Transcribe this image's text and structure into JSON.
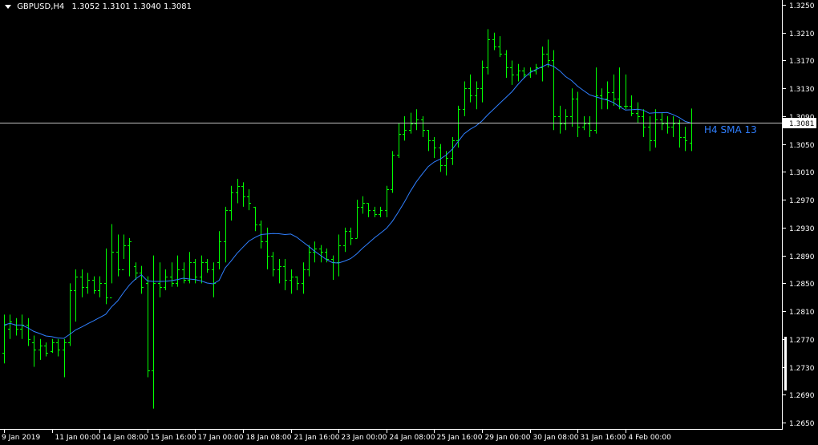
{
  "header": {
    "symbol": "GBPUSD,H4",
    "ohlc": "1.3052 1.3101 1.3040 1.3081"
  },
  "indicator_label": "H4 SMA 13",
  "current_price_label": "1.3081",
  "colors": {
    "background": "#000000",
    "bars": "#00ff00",
    "sma": "#2f7fff",
    "axis": "#ffffff",
    "price_line": "#c0c0c0",
    "price_tag_bg": "#ffffff",
    "price_tag_text": "#000000"
  },
  "chart_data": {
    "type": "ohlc",
    "symbol": "GBPUSD",
    "timeframe": "H4",
    "ylim": [
      1.2635,
      1.3265
    ],
    "y_ticks": [
      "1.3250",
      "1.3210",
      "1.3170",
      "1.3130",
      "1.3090",
      "1.3050",
      "1.3010",
      "1.2970",
      "1.2930",
      "1.2890",
      "1.2850",
      "1.2810",
      "1.2770",
      "1.2730",
      "1.2690",
      "1.2650"
    ],
    "x_ticks": [
      {
        "label": "9 Jan 2019",
        "bar": 0
      },
      {
        "label": "11 Jan 00:00",
        "bar": 8
      },
      {
        "label": "14 Jan 08:00",
        "bar": 16
      },
      {
        "label": "15 Jan 16:00",
        "bar": 24
      },
      {
        "label": "17 Jan 00:00",
        "bar": 32
      },
      {
        "label": "18 Jan 08:00",
        "bar": 40
      },
      {
        "label": "21 Jan 16:00",
        "bar": 48
      },
      {
        "label": "23 Jan 00:00",
        "bar": 56
      },
      {
        "label": "24 Jan 08:00",
        "bar": 64
      },
      {
        "label": "25 Jan 16:00",
        "bar": 72
      },
      {
        "label": "29 Jan 00:00",
        "bar": 80
      },
      {
        "label": "30 Jan 08:00",
        "bar": 88
      },
      {
        "label": "31 Jan 16:00",
        "bar": 96
      },
      {
        "label": "4 Feb 00:00",
        "bar": 104
      }
    ],
    "bars": [
      {
        "h": 1.2805,
        "l": 1.2735,
        "o": 1.275,
        "c": 1.279
      },
      {
        "h": 1.2805,
        "l": 1.277,
        "o": 1.2785,
        "c": 1.2795
      },
      {
        "h": 1.28,
        "l": 1.2775,
        "o": 1.279,
        "c": 1.2785
      },
      {
        "h": 1.2805,
        "l": 1.277,
        "o": 1.2785,
        "c": 1.279
      },
      {
        "h": 1.28,
        "l": 1.276,
        "o": 1.279,
        "c": 1.277
      },
      {
        "h": 1.2775,
        "l": 1.273,
        "o": 1.2765,
        "c": 1.2755
      },
      {
        "h": 1.277,
        "l": 1.274,
        "o": 1.2755,
        "c": 1.276
      },
      {
        "h": 1.2765,
        "l": 1.2745,
        "o": 1.276,
        "c": 1.275
      },
      {
        "h": 1.277,
        "l": 1.275,
        "o": 1.2752,
        "c": 1.2765
      },
      {
        "h": 1.277,
        "l": 1.2745,
        "o": 1.2765,
        "c": 1.2755
      },
      {
        "h": 1.277,
        "l": 1.2715,
        "o": 1.2755,
        "c": 1.2765
      },
      {
        "h": 1.285,
        "l": 1.276,
        "o": 1.2765,
        "c": 1.284
      },
      {
        "h": 1.287,
        "l": 1.2795,
        "o": 1.284,
        "c": 1.286
      },
      {
        "h": 1.287,
        "l": 1.283,
        "o": 1.286,
        "c": 1.2845
      },
      {
        "h": 1.2865,
        "l": 1.2835,
        "o": 1.2845,
        "c": 1.2855
      },
      {
        "h": 1.286,
        "l": 1.2835,
        "o": 1.2855,
        "c": 1.284
      },
      {
        "h": 1.286,
        "l": 1.283,
        "o": 1.284,
        "c": 1.285
      },
      {
        "h": 1.29,
        "l": 1.282,
        "o": 1.285,
        "c": 1.283
      },
      {
        "h": 1.2935,
        "l": 1.285,
        "o": 1.283,
        "c": 1.2895
      },
      {
        "h": 1.292,
        "l": 1.286,
        "o": 1.2895,
        "c": 1.287
      },
      {
        "h": 1.292,
        "l": 1.2885,
        "o": 1.287,
        "c": 1.2905
      },
      {
        "h": 1.2915,
        "l": 1.286,
        "o": 1.2905,
        "c": 1.291
      },
      {
        "h": 1.288,
        "l": 1.2855,
        "o": 1.2875,
        "c": 1.2865
      },
      {
        "h": 1.2875,
        "l": 1.2835,
        "o": 1.2865,
        "c": 1.2845
      },
      {
        "h": 1.286,
        "l": 1.2715,
        "o": 1.285,
        "c": 1.2725
      },
      {
        "h": 1.289,
        "l": 1.267,
        "o": 1.2725,
        "c": 1.285
      },
      {
        "h": 1.288,
        "l": 1.283,
        "o": 1.285,
        "c": 1.2845
      },
      {
        "h": 1.287,
        "l": 1.284,
        "o": 1.2845,
        "c": 1.286
      },
      {
        "h": 1.288,
        "l": 1.2845,
        "o": 1.286,
        "c": 1.285
      },
      {
        "h": 1.289,
        "l": 1.2845,
        "o": 1.285,
        "c": 1.287
      },
      {
        "h": 1.288,
        "l": 1.285,
        "o": 1.287,
        "c": 1.2855
      },
      {
        "h": 1.2895,
        "l": 1.285,
        "o": 1.2855,
        "c": 1.288
      },
      {
        "h": 1.2885,
        "l": 1.285,
        "o": 1.288,
        "c": 1.286
      },
      {
        "h": 1.289,
        "l": 1.285,
        "o": 1.286,
        "c": 1.288
      },
      {
        "h": 1.2885,
        "l": 1.2865,
        "o": 1.288,
        "c": 1.287
      },
      {
        "h": 1.288,
        "l": 1.283,
        "o": 1.287,
        "c": 1.285
      },
      {
        "h": 1.2925,
        "l": 1.287,
        "o": 1.288,
        "c": 1.291
      },
      {
        "h": 1.296,
        "l": 1.288,
        "o": 1.291,
        "c": 1.2955
      },
      {
        "h": 1.299,
        "l": 1.294,
        "o": 1.2955,
        "c": 1.298
      },
      {
        "h": 1.3,
        "l": 1.2965,
        "o": 1.298,
        "c": 1.299
      },
      {
        "h": 1.2995,
        "l": 1.296,
        "o": 1.299,
        "c": 1.2975
      },
      {
        "h": 1.2985,
        "l": 1.2955,
        "o": 1.2975,
        "c": 1.2965
      },
      {
        "h": 1.296,
        "l": 1.2925,
        "o": 1.296,
        "c": 1.2935
      },
      {
        "h": 1.294,
        "l": 1.29,
        "o": 1.2935,
        "c": 1.291
      },
      {
        "h": 1.293,
        "l": 1.287,
        "o": 1.291,
        "c": 1.289
      },
      {
        "h": 1.2895,
        "l": 1.286,
        "o": 1.289,
        "c": 1.287
      },
      {
        "h": 1.2885,
        "l": 1.285,
        "o": 1.287,
        "c": 1.2875
      },
      {
        "h": 1.2885,
        "l": 1.284,
        "o": 1.2875,
        "c": 1.2855
      },
      {
        "h": 1.287,
        "l": 1.2835,
        "o": 1.2855,
        "c": 1.286
      },
      {
        "h": 1.286,
        "l": 1.284,
        "o": 1.286,
        "c": 1.285
      },
      {
        "h": 1.288,
        "l": 1.2835,
        "o": 1.285,
        "c": 1.287
      },
      {
        "h": 1.2905,
        "l": 1.286,
        "o": 1.287,
        "c": 1.2895
      },
      {
        "h": 1.291,
        "l": 1.288,
        "o": 1.2895,
        "c": 1.29
      },
      {
        "h": 1.2905,
        "l": 1.288,
        "o": 1.29,
        "c": 1.2895
      },
      {
        "h": 1.29,
        "l": 1.288,
        "o": 1.2895,
        "c": 1.2885
      },
      {
        "h": 1.289,
        "l": 1.2855,
        "o": 1.2885,
        "c": 1.288
      },
      {
        "h": 1.292,
        "l": 1.286,
        "o": 1.288,
        "c": 1.2905
      },
      {
        "h": 1.293,
        "l": 1.2895,
        "o": 1.2905,
        "c": 1.2925
      },
      {
        "h": 1.293,
        "l": 1.2905,
        "o": 1.2925,
        "c": 1.2915
      },
      {
        "h": 1.297,
        "l": 1.2915,
        "o": 1.2915,
        "c": 1.296
      },
      {
        "h": 1.2975,
        "l": 1.295,
        "o": 1.296,
        "c": 1.2965
      },
      {
        "h": 1.2965,
        "l": 1.2945,
        "o": 1.2965,
        "c": 1.2955
      },
      {
        "h": 1.296,
        "l": 1.2945,
        "o": 1.2955,
        "c": 1.295
      },
      {
        "h": 1.296,
        "l": 1.2945,
        "o": 1.295,
        "c": 1.2955
      },
      {
        "h": 1.299,
        "l": 1.2945,
        "o": 1.2955,
        "c": 1.2985
      },
      {
        "h": 1.304,
        "l": 1.298,
        "o": 1.2985,
        "c": 1.3035
      },
      {
        "h": 1.308,
        "l": 1.303,
        "o": 1.3035,
        "c": 1.3065
      },
      {
        "h": 1.309,
        "l": 1.3055,
        "o": 1.3065,
        "c": 1.307
      },
      {
        "h": 1.3095,
        "l": 1.3065,
        "o": 1.307,
        "c": 1.308
      },
      {
        "h": 1.31,
        "l": 1.307,
        "o": 1.308,
        "c": 1.3085
      },
      {
        "h": 1.309,
        "l": 1.306,
        "o": 1.3085,
        "c": 1.307
      },
      {
        "h": 1.307,
        "l": 1.304,
        "o": 1.307,
        "c": 1.3055
      },
      {
        "h": 1.306,
        "l": 1.303,
        "o": 1.3055,
        "c": 1.3045
      },
      {
        "h": 1.305,
        "l": 1.301,
        "o": 1.3045,
        "c": 1.302
      },
      {
        "h": 1.304,
        "l": 1.3005,
        "o": 1.302,
        "c": 1.303
      },
      {
        "h": 1.306,
        "l": 1.302,
        "o": 1.303,
        "c": 1.3055
      },
      {
        "h": 1.3105,
        "l": 1.3045,
        "o": 1.3055,
        "c": 1.31
      },
      {
        "h": 1.314,
        "l": 1.309,
        "o": 1.31,
        "c": 1.313
      },
      {
        "h": 1.315,
        "l": 1.311,
        "o": 1.313,
        "c": 1.312
      },
      {
        "h": 1.314,
        "l": 1.31,
        "o": 1.312,
        "c": 1.313
      },
      {
        "h": 1.317,
        "l": 1.311,
        "o": 1.313,
        "c": 1.316
      },
      {
        "h": 1.3215,
        "l": 1.315,
        "o": 1.316,
        "c": 1.32
      },
      {
        "h": 1.321,
        "l": 1.3185,
        "o": 1.32,
        "c": 1.319
      },
      {
        "h": 1.3205,
        "l": 1.3175,
        "o": 1.319,
        "c": 1.318
      },
      {
        "h": 1.3185,
        "l": 1.3145,
        "o": 1.318,
        "c": 1.316
      },
      {
        "h": 1.317,
        "l": 1.3135,
        "o": 1.316,
        "c": 1.315
      },
      {
        "h": 1.3165,
        "l": 1.314,
        "o": 1.315,
        "c": 1.3155
      },
      {
        "h": 1.316,
        "l": 1.3145,
        "o": 1.3155,
        "c": 1.315
      },
      {
        "h": 1.316,
        "l": 1.3145,
        "o": 1.315,
        "c": 1.3155
      },
      {
        "h": 1.3165,
        "l": 1.315,
        "o": 1.3155,
        "c": 1.316
      },
      {
        "h": 1.319,
        "l": 1.314,
        "o": 1.316,
        "c": 1.318
      },
      {
        "h": 1.32,
        "l": 1.316,
        "o": 1.318,
        "c": 1.317
      },
      {
        "h": 1.3185,
        "l": 1.307,
        "o": 1.317,
        "c": 1.309
      },
      {
        "h": 1.3105,
        "l": 1.3065,
        "o": 1.309,
        "c": 1.308
      },
      {
        "h": 1.31,
        "l": 1.307,
        "o": 1.308,
        "c": 1.309
      },
      {
        "h": 1.313,
        "l": 1.3075,
        "o": 1.309,
        "c": 1.3115
      },
      {
        "h": 1.3125,
        "l": 1.306,
        "o": 1.3115,
        "c": 1.3075
      },
      {
        "h": 1.309,
        "l": 1.307,
        "o": 1.3075,
        "c": 1.308
      },
      {
        "h": 1.309,
        "l": 1.306,
        "o": 1.308,
        "c": 1.307
      },
      {
        "h": 1.316,
        "l": 1.3065,
        "o": 1.307,
        "c": 1.312
      },
      {
        "h": 1.313,
        "l": 1.31,
        "o": 1.312,
        "c": 1.3115
      },
      {
        "h": 1.314,
        "l": 1.31,
        "o": 1.3115,
        "c": 1.3125
      },
      {
        "h": 1.315,
        "l": 1.3105,
        "o": 1.3125,
        "c": 1.3115
      },
      {
        "h": 1.316,
        "l": 1.31,
        "o": 1.3115,
        "c": 1.3105
      },
      {
        "h": 1.315,
        "l": 1.31,
        "o": 1.3105,
        "c": 1.3105
      },
      {
        "h": 1.312,
        "l": 1.309,
        "o": 1.3105,
        "c": 1.3095
      },
      {
        "h": 1.311,
        "l": 1.308,
        "o": 1.3095,
        "c": 1.309
      },
      {
        "h": 1.31,
        "l": 1.306,
        "o": 1.309,
        "c": 1.3075
      },
      {
        "h": 1.309,
        "l": 1.304,
        "o": 1.3075,
        "c": 1.3055
      },
      {
        "h": 1.31,
        "l": 1.3045,
        "o": 1.3055,
        "c": 1.3085
      },
      {
        "h": 1.3095,
        "l": 1.307,
        "o": 1.3085,
        "c": 1.308
      },
      {
        "h": 1.309,
        "l": 1.3065,
        "o": 1.308,
        "c": 1.3075
      },
      {
        "h": 1.309,
        "l": 1.306,
        "o": 1.3075,
        "c": 1.308
      },
      {
        "h": 1.3085,
        "l": 1.3045,
        "o": 1.308,
        "c": 1.306
      },
      {
        "h": 1.3075,
        "l": 1.304,
        "o": 1.306,
        "c": 1.3055
      },
      {
        "h": 1.3101,
        "l": 1.304,
        "o": 1.3052,
        "c": 1.3081
      }
    ],
    "sma": {
      "name": "H4 SMA 13",
      "period": 13
    },
    "last_price": 1.3081
  }
}
